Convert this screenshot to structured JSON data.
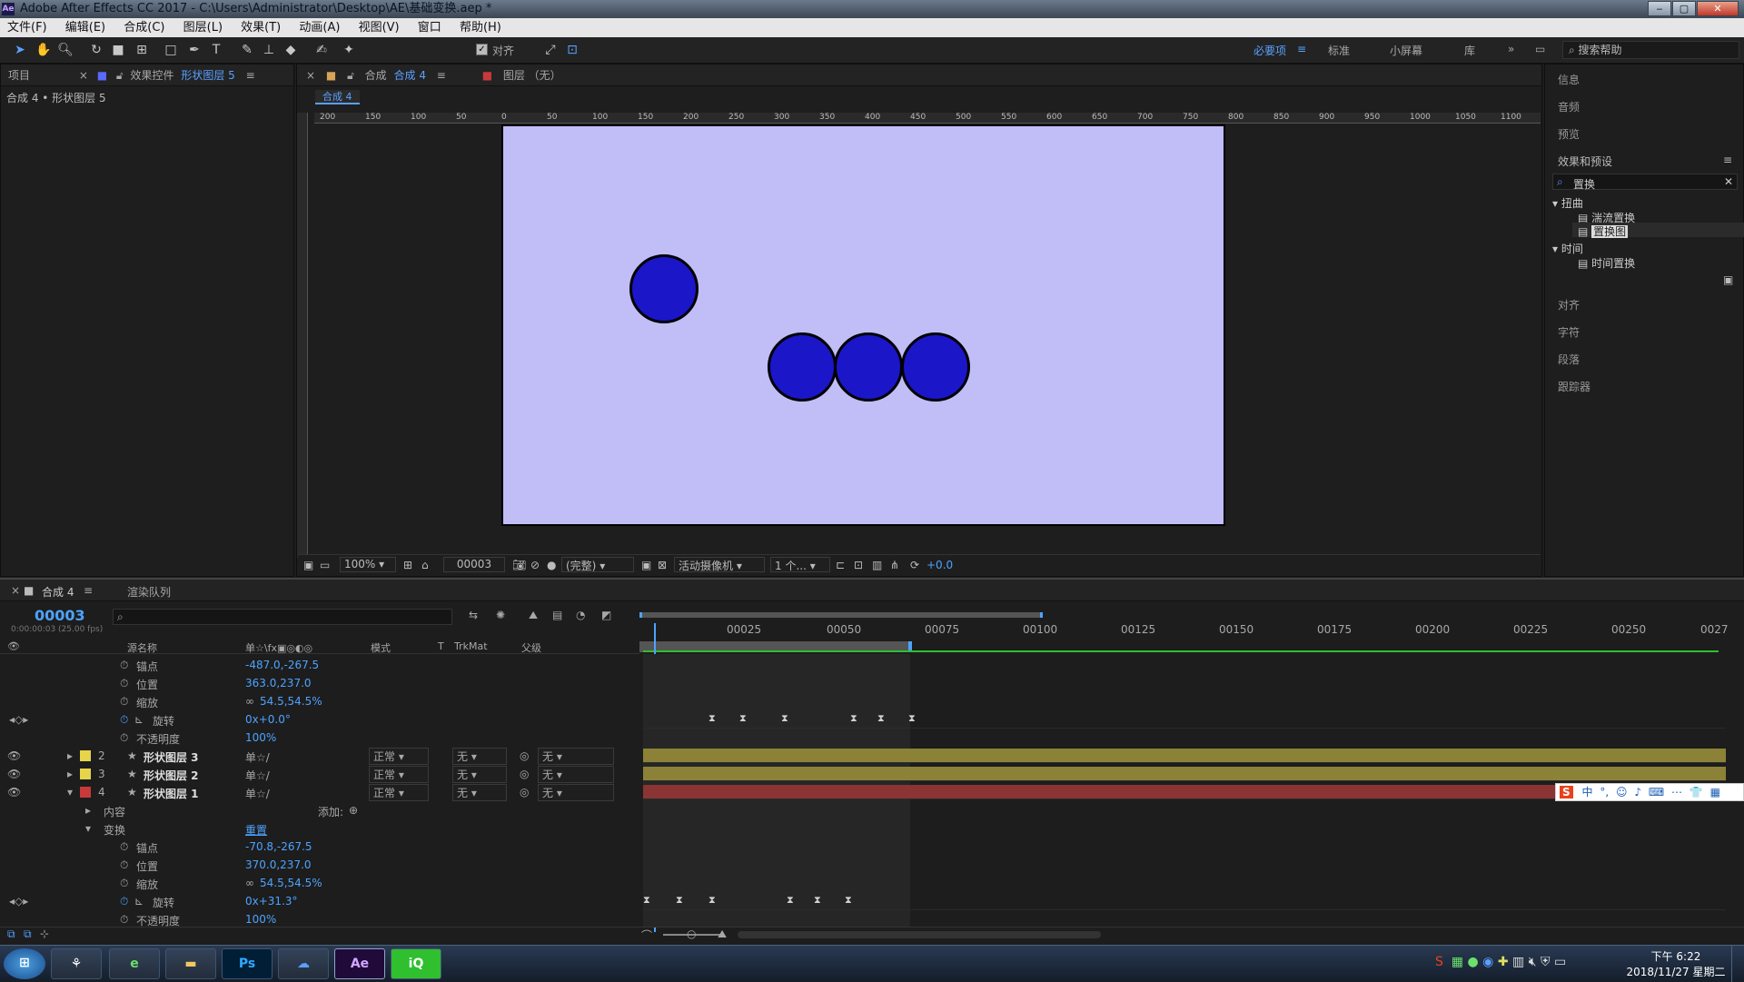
{
  "window": {
    "title": "Adobe After Effects CC 2017 - C:\\Users\\Administrator\\Desktop\\AE\\基础变换.aep *",
    "app_badge": "Ae"
  },
  "menu": [
    "文件(F)",
    "编辑(E)",
    "合成(C)",
    "图层(L)",
    "效果(T)",
    "动画(A)",
    "视图(V)",
    "窗口",
    "帮助(H)"
  ],
  "toolbar": {
    "snap_label": "对齐",
    "workspaces": [
      "必要项",
      "标准",
      "小屏幕",
      "库"
    ],
    "search_help": "搜索帮助",
    "icons": [
      "selection-tool-icon",
      "hand-tool-icon",
      "zoom-tool-icon",
      "rotate-tool-icon",
      "camera-tool-icon",
      "pan-behind-tool-icon",
      "rectangle-tool-icon",
      "pen-tool-icon",
      "type-tool-icon",
      "brush-tool-icon",
      "clone-stamp-tool-icon",
      "eraser-tool-icon",
      "roto-brush-tool-icon",
      "puppet-tool-icon"
    ]
  },
  "project_panel": {
    "tab_project": "项目",
    "tab_effects_prefix": "效果控件",
    "tab_effects_layer": "形状图层 5",
    "breadcrumb": "合成 4 • 形状图层 5"
  },
  "comp_panel": {
    "tab_prefix": "合成",
    "tab_comp_name": "合成 4",
    "layer_tab": "图层 （无）",
    "subtab": "合成 4"
  },
  "ruler_h": [
    "200",
    "150",
    "100",
    "50",
    "0",
    "50",
    "100",
    "150",
    "200",
    "250",
    "300",
    "350",
    "400",
    "450",
    "500",
    "550",
    "600",
    "650",
    "700",
    "750",
    "800",
    "850",
    "900",
    "950",
    "1000",
    "1050",
    "1100"
  ],
  "viewer_bar": {
    "zoom": "100%",
    "timecode": "00003",
    "resolution": "(完整)",
    "camera": "活动摄像机",
    "views": "1 个...",
    "exposure": "+0.0"
  },
  "right_panel": {
    "items_top": [
      "信息",
      "音频",
      "预览"
    ],
    "effects_title": "效果和预设",
    "search_value": "置换",
    "tree": [
      {
        "group": "扭曲",
        "children": [
          "湍流置换",
          "置换图"
        ]
      },
      {
        "group": "时间",
        "children": [
          "时间置换"
        ]
      }
    ],
    "items_bottom": [
      "对齐",
      "字符",
      "段落",
      "跟踪器"
    ]
  },
  "timeline": {
    "tab": "合成 4",
    "render_queue": "渲染队列",
    "timecode": "00003",
    "timecode_sub": "0:00:00:03 (25.00 fps)",
    "columns": {
      "source": "源名称",
      "mode": "模式",
      "t": "T",
      "trkmat": "TrkMat",
      "parent": "父级"
    },
    "ruler": [
      "00025",
      "00050",
      "00075",
      "00100",
      "00125",
      "00150",
      "00175",
      "00200",
      "00225",
      "00250",
      "0027"
    ],
    "top_props": [
      {
        "name": "锚点",
        "value": "-487.0,-267.5"
      },
      {
        "name": "位置",
        "value": "363.0,237.0"
      },
      {
        "name": "缩放",
        "value": "54.5,54.5%"
      },
      {
        "name": "旋转",
        "value": "0x+0.0°"
      },
      {
        "name": "不透明度",
        "value": "100%"
      }
    ],
    "layers": [
      {
        "num": "2",
        "name": "形状图层 3",
        "mode": "正常",
        "trkmat": "无",
        "parent": "无",
        "color": "#e6d44a"
      },
      {
        "num": "3",
        "name": "形状图层 2",
        "mode": "正常",
        "trkmat": "无",
        "parent": "无",
        "color": "#e6d44a"
      },
      {
        "num": "4",
        "name": "形状图层 1",
        "mode": "正常",
        "trkmat": "无",
        "parent": "无",
        "color": "#c83a3a"
      }
    ],
    "content_label": "内容",
    "add_label": "添加:",
    "transform_label": "变换",
    "reset_label": "重置",
    "bottom_props": [
      {
        "name": "锚点",
        "value": "-70.8,-267.5"
      },
      {
        "name": "位置",
        "value": "370.0,237.0"
      },
      {
        "name": "缩放",
        "value": "54.5,54.5%"
      },
      {
        "name": "旋转",
        "value": "0x+31.3°"
      },
      {
        "name": "不透明度",
        "value": "100%"
      }
    ]
  },
  "taskbar": {
    "apps": [
      "Windows",
      "资源",
      "IE",
      "文件",
      "Ps",
      "网盘",
      "Ae",
      "爱奇艺"
    ],
    "time": "下午 6:22",
    "date": "2018/11/27 星期二"
  },
  "ime": [
    "S",
    "中",
    "°,",
    "☺",
    "♪",
    "⌨",
    "⋯",
    "👕",
    "▦"
  ],
  "colors": {
    "accent": "#4da3ff",
    "canvas_bg": "#c0bdf7",
    "circle_fill": "#1b16c8",
    "layer_bar_yellow": "#8b8238",
    "layer_bar_red": "#8a3434"
  }
}
